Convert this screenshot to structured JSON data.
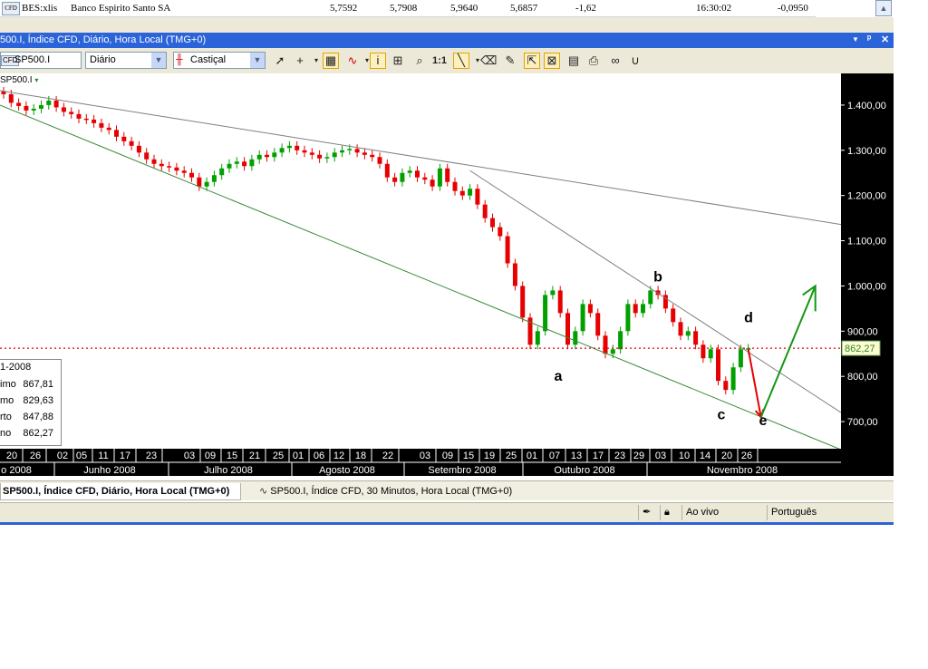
{
  "quote_row": {
    "symbol": "BES:xlis",
    "name": "Banco Espirito Santo SA",
    "values": [
      "5,7592",
      "5,7908",
      "5,9640",
      "5,6857",
      "-1,62"
    ],
    "time": "16:30:02",
    "change": "-0,0950"
  },
  "window": {
    "title": "500.I, Índice CFD, Diário, Hora Local (TMG+0)"
  },
  "toolbar": {
    "symbol_value": "SP500.I",
    "symbol_icon": "cfd-icon",
    "interval_value": "Diário",
    "chart_type_value": "Castiçal",
    "ratio_label": "1:1"
  },
  "chart": {
    "instrument_label": "SP500.I",
    "price_ticks": [
      "1.400,00",
      "1.300,00",
      "1.200,00",
      "1.100,00",
      "1.000,00",
      "900,00",
      "800,00",
      "700,00"
    ],
    "current_price": "862,27",
    "colors": {
      "up": "#00a000",
      "down": "#e60000",
      "trend": "#7f7f7f",
      "support": "#3a8a3a",
      "arrow_down": "#e60000",
      "arrow_up": "#149614",
      "price_line": "#e60000"
    },
    "wave_labels": [
      "a",
      "b",
      "c",
      "d",
      "e"
    ],
    "date_days": [
      "20",
      "26",
      "02",
      "05",
      "11",
      "17",
      "23",
      "03",
      "09",
      "15",
      "21",
      "25",
      "01",
      "06",
      "12",
      "18",
      "22",
      "03",
      "09",
      "15",
      "19",
      "25",
      "01",
      "07",
      "13",
      "17",
      "23",
      "29",
      "03",
      "10",
      "14",
      "20",
      "26"
    ],
    "months": [
      "o 2008",
      "Junho 2008",
      "Julho 2008",
      "Agosto 2008",
      "Setembro 2008",
      "Outubro 2008",
      "Novembro 2008"
    ]
  },
  "ohlc_panel": {
    "header": "1-2008",
    "rows": [
      {
        "label": "imo",
        "value": "867,81"
      },
      {
        "label": "mo",
        "value": "829,63"
      },
      {
        "label": "rto",
        "value": "847,88"
      },
      {
        "label": "no",
        "value": "862,27"
      }
    ]
  },
  "tabs": [
    {
      "label": "SP500.I, Índice CFD, Diário, Hora Local (TMG+0)",
      "active": true
    },
    {
      "label": "SP500.I, Índice CFD, 30 Minutos, Hora Local (TMG+0)",
      "active": false
    }
  ],
  "status": {
    "live_label": "Ao vivo",
    "language": "Português"
  },
  "chart_data": {
    "type": "candlestick",
    "ylim": [
      640,
      1470
    ],
    "yticks": [
      1400,
      1300,
      1200,
      1100,
      1000,
      900,
      800,
      700
    ],
    "last_price": 862.27,
    "close": [
      1424,
      1405,
      1398,
      1388,
      1392,
      1400,
      1410,
      1395,
      1385,
      1380,
      1370,
      1368,
      1360,
      1350,
      1345,
      1330,
      1320,
      1310,
      1295,
      1280,
      1270,
      1265,
      1262,
      1255,
      1250,
      1240,
      1220,
      1230,
      1245,
      1260,
      1270,
      1275,
      1265,
      1280,
      1290,
      1285,
      1295,
      1305,
      1310,
      1300,
      1295,
      1290,
      1282,
      1285,
      1295,
      1300,
      1303,
      1295,
      1290,
      1285,
      1270,
      1240,
      1230,
      1250,
      1255,
      1240,
      1235,
      1220,
      1260,
      1230,
      1210,
      1200,
      1215,
      1180,
      1150,
      1130,
      1110,
      1050,
      1000,
      930,
      870,
      900,
      980,
      990,
      940,
      870,
      900,
      960,
      940,
      890,
      850,
      860,
      900,
      960,
      940,
      960,
      990,
      980,
      950,
      920,
      890,
      900,
      870,
      840,
      860,
      790,
      770,
      820,
      860,
      862
    ]
  }
}
